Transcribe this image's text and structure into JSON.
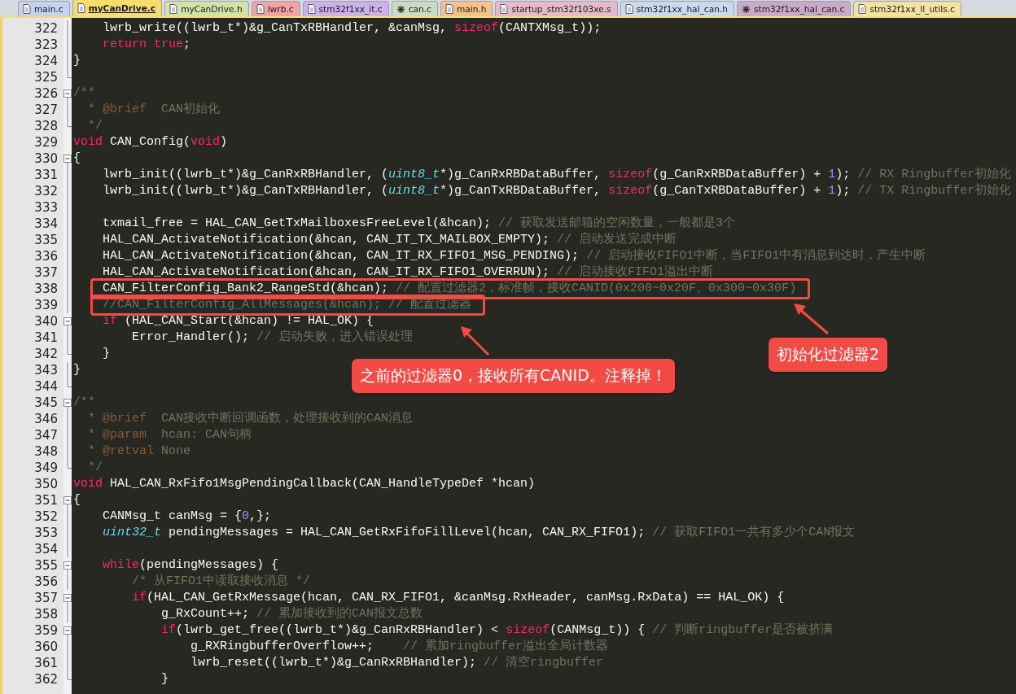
{
  "tabs": [
    {
      "label": "main.c",
      "color": "#c6d3f0",
      "selected": false,
      "marked": false
    },
    {
      "label": "myCanDrive.c",
      "color": "#f6dd6e",
      "selected": true,
      "marked": false
    },
    {
      "label": "myCanDrive.h",
      "color": "#d2e2a8",
      "selected": false,
      "marked": false
    },
    {
      "label": "lwrb.c",
      "color": "#f2a4a4",
      "selected": false,
      "marked": false
    },
    {
      "label": "stm32f1xx_it.c",
      "color": "#cbb2ea",
      "selected": false,
      "marked": false
    },
    {
      "label": "can.c",
      "color": "#c8dcc2",
      "selected": false,
      "marked": true
    },
    {
      "label": "main.h",
      "color": "#f6c28c",
      "selected": false,
      "marked": false
    },
    {
      "label": "startup_stm32f103xe.s",
      "color": "#e2bccc",
      "selected": false,
      "marked": false
    },
    {
      "label": "stm32f1xx_hal_can.h",
      "color": "#cadaee",
      "selected": false,
      "marked": false
    },
    {
      "label": "stm32f1xx_hal_can.c",
      "color": "#c9aac9",
      "selected": false,
      "marked": true
    },
    {
      "label": "stm32f1xx_ll_utils.c",
      "color": "#f3e2a4",
      "selected": false,
      "marked": false
    }
  ],
  "editor": {
    "lines": [
      {
        "no": "322",
        "kind": "body",
        "highlighted": false,
        "tokens": [
          {
            "kind": "plain",
            "text": "    lwrb_write((lwrb_t*)&g_CanTxRBHandler, &canMsg, "
          },
          {
            "kind": "keyword",
            "text": "sizeof"
          },
          {
            "kind": "plain",
            "text": "(CANTXMsg_t));"
          }
        ]
      },
      {
        "no": "323",
        "kind": "body",
        "highlighted": false,
        "tokens": [
          {
            "kind": "keyword",
            "text": "    return "
          },
          {
            "kind": "keyword",
            "text": "true"
          },
          {
            "kind": "plain",
            "text": ";"
          }
        ]
      },
      {
        "no": "324",
        "kind": "body",
        "highlighted": false,
        "tokens": [
          {
            "kind": "plain",
            "text": "}"
          }
        ]
      },
      {
        "no": "325",
        "kind": "end",
        "highlighted": false
      },
      {
        "no": "326",
        "kind": "start",
        "highlighted": false,
        "tokens": [
          {
            "kind": "comment",
            "text": "/**"
          }
        ]
      },
      {
        "no": "327",
        "kind": "body",
        "highlighted": false,
        "tokens": [
          {
            "kind": "comment",
            "text": "  * "
          },
          {
            "kind": "tag",
            "text": "@brief"
          },
          {
            "kind": "comment",
            "text": "  CAN初始化"
          }
        ]
      },
      {
        "no": "328",
        "kind": "end",
        "highlighted": false,
        "tokens": [
          {
            "kind": "comment",
            "text": "  */"
          }
        ]
      },
      {
        "no": "329",
        "kind": "plain",
        "highlighted": false,
        "tokens": [
          {
            "kind": "keyword",
            "text": "void"
          },
          {
            "kind": "plain",
            "text": " CAN_Config("
          },
          {
            "kind": "keyword",
            "text": "void"
          },
          {
            "kind": "plain",
            "text": ")"
          }
        ]
      },
      {
        "no": "330",
        "kind": "start",
        "highlighted": false,
        "tokens": [
          {
            "kind": "plain",
            "text": "{"
          }
        ]
      },
      {
        "no": "331",
        "kind": "body",
        "highlighted": false,
        "tokens": [
          {
            "kind": "plain",
            "text": "    lwrb_init((lwrb_t*)&g_CanRxRBHandler, ("
          },
          {
            "kind": "type",
            "text": "uint8_t"
          },
          {
            "kind": "plain",
            "text": "*)g_CanRxRBDataBuffer, "
          },
          {
            "kind": "keyword",
            "text": "sizeof"
          },
          {
            "kind": "plain",
            "text": "(g_CanRxRBDataBuffer) + "
          },
          {
            "kind": "number",
            "text": "1"
          },
          {
            "kind": "plain",
            "text": "); "
          },
          {
            "kind": "comment",
            "text": "// RX Ringbuffer初始化"
          }
        ]
      },
      {
        "no": "332",
        "kind": "body",
        "highlighted": false,
        "tokens": [
          {
            "kind": "plain",
            "text": "    lwrb_init((lwrb_t*)&g_CanTxRBHandler, ("
          },
          {
            "kind": "type",
            "text": "uint8_t"
          },
          {
            "kind": "plain",
            "text": "*)g_CanTxRBDataBuffer, "
          },
          {
            "kind": "keyword",
            "text": "sizeof"
          },
          {
            "kind": "plain",
            "text": "(g_CanTxRBDataBuffer) + "
          },
          {
            "kind": "number",
            "text": "1"
          },
          {
            "kind": "plain",
            "text": "); "
          },
          {
            "kind": "comment",
            "text": "// TX Ringbuffer初始化"
          }
        ]
      },
      {
        "no": "333",
        "kind": "body",
        "highlighted": false
      },
      {
        "no": "334",
        "kind": "body",
        "highlighted": false,
        "tokens": [
          {
            "kind": "plain",
            "text": "    txmail_free = HAL_CAN_GetTxMailboxesFreeLevel(&hcan); "
          },
          {
            "kind": "comment",
            "text": "// 获取发送邮箱的空闲数量，一般都是3个"
          }
        ]
      },
      {
        "no": "335",
        "kind": "body",
        "highlighted": false,
        "tokens": [
          {
            "kind": "plain",
            "text": "    HAL_CAN_ActivateNotification(&hcan, CAN_IT_TX_MAILBOX_EMPTY); "
          },
          {
            "kind": "comment",
            "text": "// 启动发送完成中断"
          }
        ]
      },
      {
        "no": "336",
        "kind": "body",
        "highlighted": false,
        "tokens": [
          {
            "kind": "plain",
            "text": "    HAL_CAN_ActivateNotification(&hcan, CAN_IT_RX_FIFO1_MSG_PENDING); "
          },
          {
            "kind": "comment",
            "text": "// 启动接收FIFO1中断，当FIFO1中有消息到达时，产生中断"
          }
        ]
      },
      {
        "no": "337",
        "kind": "body",
        "highlighted": false,
        "tokens": [
          {
            "kind": "plain",
            "text": "    HAL_CAN_ActivateNotification(&hcan, CAN_IT_RX_FIFO1_OVERRUN); "
          },
          {
            "kind": "comment",
            "text": "// 启动接收FIFO1溢出中断"
          }
        ]
      },
      {
        "no": "338",
        "kind": "body",
        "highlighted": true,
        "tokens": [
          {
            "kind": "plain",
            "text": "    CAN_FilterConfig_Bank2_RangeStd(&hcan); "
          },
          {
            "kind": "comment",
            "text": "// 配置过滤器2，标准帧，接收CANID(0x200~0x20F、0x300~0x30F)"
          }
        ]
      },
      {
        "no": "339",
        "kind": "body",
        "highlighted": true,
        "tokens": [
          {
            "kind": "comment",
            "text": "    //CAN_FilterConfig_AllMessages(&hcan); // 配置过滤器"
          }
        ]
      },
      {
        "no": "340",
        "kind": "start",
        "highlighted": false,
        "tokens": [
          {
            "kind": "keyword",
            "text": "    if"
          },
          {
            "kind": "plain",
            "text": " (HAL_CAN_Start(&hcan) != HAL_OK) {"
          }
        ]
      },
      {
        "no": "341",
        "kind": "body",
        "highlighted": false,
        "tokens": [
          {
            "kind": "plain",
            "text": "        Error_Handler(); "
          },
          {
            "kind": "comment",
            "text": "// 启动失败，进入错误处理"
          }
        ]
      },
      {
        "no": "342",
        "kind": "end",
        "highlighted": false,
        "tokens": [
          {
            "kind": "plain",
            "text": "    }"
          }
        ]
      },
      {
        "no": "343",
        "kind": "body",
        "highlighted": false,
        "tokens": [
          {
            "kind": "plain",
            "text": "}"
          }
        ]
      },
      {
        "no": "344",
        "kind": "end",
        "highlighted": false
      },
      {
        "no": "345",
        "kind": "start",
        "highlighted": false,
        "tokens": [
          {
            "kind": "comment",
            "text": "/**"
          }
        ]
      },
      {
        "no": "346",
        "kind": "body",
        "highlighted": false,
        "tokens": [
          {
            "kind": "comment",
            "text": "  * "
          },
          {
            "kind": "tag",
            "text": "@brief"
          },
          {
            "kind": "comment",
            "text": "  CAN接收中断回调函数，处理接收到的CAN消息"
          }
        ]
      },
      {
        "no": "347",
        "kind": "body",
        "highlighted": false,
        "tokens": [
          {
            "kind": "comment",
            "text": "  * "
          },
          {
            "kind": "tag",
            "text": "@param"
          },
          {
            "kind": "comment",
            "text": "  hcan: CAN句柄"
          }
        ]
      },
      {
        "no": "348",
        "kind": "body",
        "highlighted": false,
        "tokens": [
          {
            "kind": "comment",
            "text": "  * "
          },
          {
            "kind": "tag",
            "text": "@retval"
          },
          {
            "kind": "comment",
            "text": " None"
          }
        ]
      },
      {
        "no": "349",
        "kind": "end",
        "highlighted": false,
        "tokens": [
          {
            "kind": "comment",
            "text": "  */"
          }
        ]
      },
      {
        "no": "350",
        "kind": "plain",
        "highlighted": false,
        "tokens": [
          {
            "kind": "keyword",
            "text": "void"
          },
          {
            "kind": "plain",
            "text": " HAL_CAN_RxFifo1MsgPendingCallback(CAN_HandleTypeDef *hcan)"
          }
        ]
      },
      {
        "no": "351",
        "kind": "start",
        "highlighted": false,
        "tokens": [
          {
            "kind": "plain",
            "text": "{"
          }
        ]
      },
      {
        "no": "352",
        "kind": "body",
        "highlighted": false,
        "tokens": [
          {
            "kind": "plain",
            "text": "    CANMsg_t canMsg = {"
          },
          {
            "kind": "number",
            "text": "0"
          },
          {
            "kind": "plain",
            "text": ",};"
          }
        ]
      },
      {
        "no": "353",
        "kind": "body",
        "highlighted": false,
        "tokens": [
          {
            "kind": "type",
            "text": "    uint32_t"
          },
          {
            "kind": "plain",
            "text": " pendingMessages = HAL_CAN_GetRxFifoFillLevel(hcan, CAN_RX_FIFO1); "
          },
          {
            "kind": "comment",
            "text": "// 获取FIFO1一共有多少个CAN报文"
          }
        ]
      },
      {
        "no": "354",
        "kind": "body",
        "highlighted": false
      },
      {
        "no": "355",
        "kind": "start",
        "highlighted": false,
        "tokens": [
          {
            "kind": "keyword",
            "text": "    while"
          },
          {
            "kind": "plain",
            "text": "(pendingMessages) {"
          }
        ]
      },
      {
        "no": "356",
        "kind": "body",
        "highlighted": false,
        "tokens": [
          {
            "kind": "comment",
            "text": "        /* 从FIFO1中读取接收消息 */"
          }
        ]
      },
      {
        "no": "357",
        "kind": "start",
        "highlighted": false,
        "tokens": [
          {
            "kind": "keyword",
            "text": "        if"
          },
          {
            "kind": "plain",
            "text": "(HAL_CAN_GetRxMessage(hcan, CAN_RX_FIFO1, &canMsg.RxHeader, canMsg.RxData) == HAL_OK) {"
          }
        ]
      },
      {
        "no": "358",
        "kind": "body",
        "highlighted": false,
        "tokens": [
          {
            "kind": "plain",
            "text": "            g_RxCount++; "
          },
          {
            "kind": "comment",
            "text": "// 累加接收到的CAN报文总数"
          }
        ]
      },
      {
        "no": "359",
        "kind": "start",
        "highlighted": false,
        "tokens": [
          {
            "kind": "keyword",
            "text": "            if"
          },
          {
            "kind": "plain",
            "text": "(lwrb_get_free((lwrb_t*)&g_CanRxRBHandler) < "
          },
          {
            "kind": "keyword",
            "text": "sizeof"
          },
          {
            "kind": "plain",
            "text": "(CANMsg_t)) { "
          },
          {
            "kind": "comment",
            "text": "// 判断ringbuffer是否被挤满"
          }
        ]
      },
      {
        "no": "360",
        "kind": "body",
        "highlighted": false,
        "tokens": [
          {
            "kind": "plain",
            "text": "                g_RXRingbufferOverflow++;    "
          },
          {
            "kind": "comment",
            "text": "// 累加ringbuffer溢出全局计数器"
          }
        ]
      },
      {
        "no": "361",
        "kind": "body",
        "highlighted": false,
        "tokens": [
          {
            "kind": "plain",
            "text": "                lwrb_reset((lwrb_t*)&g_CanRxRBHandler); "
          },
          {
            "kind": "comment",
            "text": "// 清空ringbuffer"
          }
        ]
      },
      {
        "no": "362",
        "kind": "end",
        "highlighted": false,
        "tokens": [
          {
            "kind": "plain",
            "text": "            }"
          }
        ]
      }
    ]
  },
  "callouts": [
    {
      "text": "之前的过滤器0，接收所有CANID。注释掉！"
    },
    {
      "text": "初始化过滤器2"
    }
  ]
}
